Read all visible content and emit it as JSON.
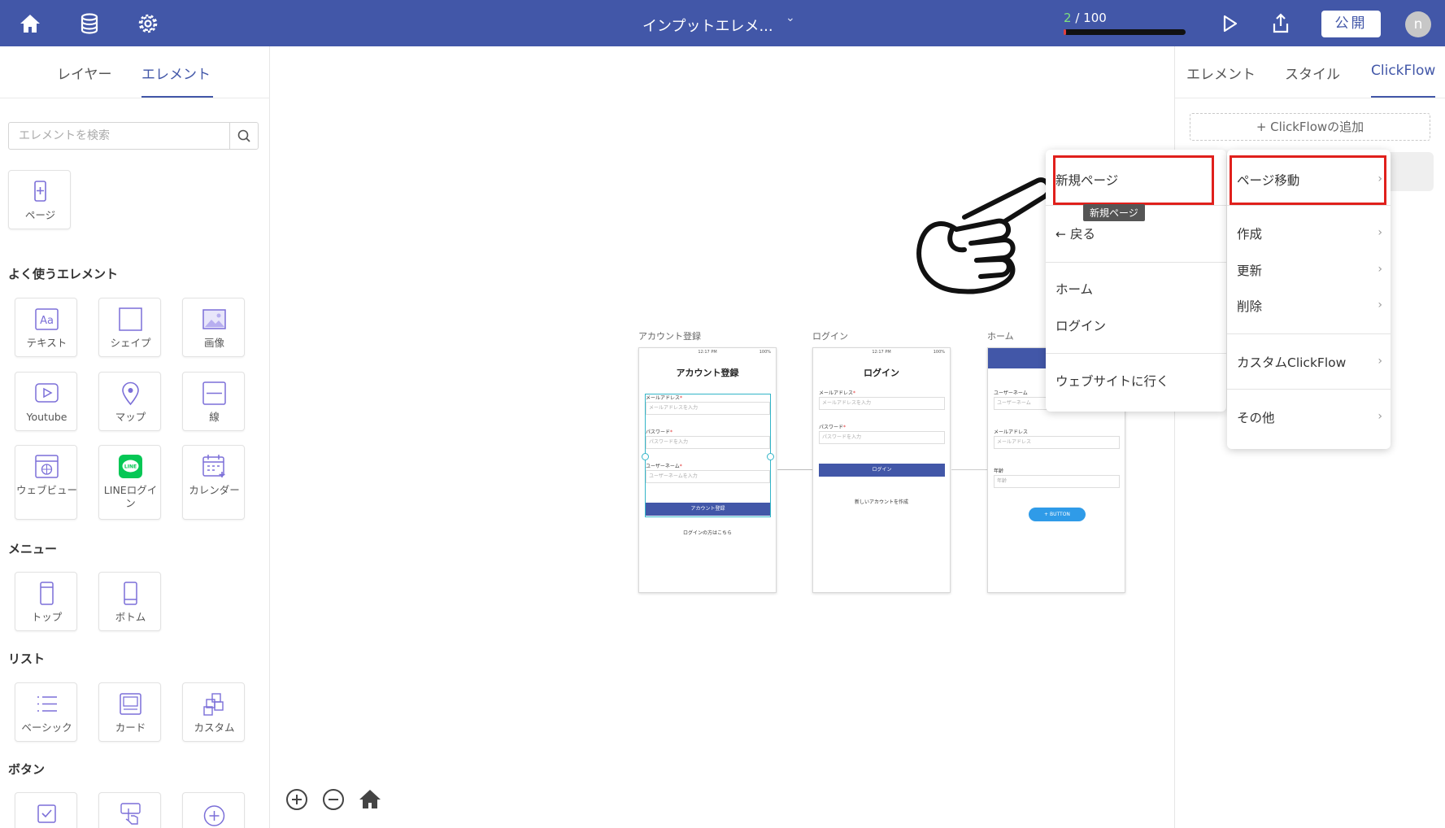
{
  "topbar": {
    "title": "インプットエレメ...",
    "progress_current": "2",
    "progress_total": "/ 100",
    "progress_fraction": 0.02,
    "publish_label": "公開",
    "avatar_initial": "n",
    "colors": {
      "bar": "#4257a8",
      "progress_current": "#7ee07e"
    },
    "icons": [
      "home-icon",
      "database-icon",
      "settings-icon",
      "chevron-down-icon",
      "play-icon",
      "share-icon"
    ]
  },
  "left_panel": {
    "tabs": [
      "レイヤー",
      "エレメント"
    ],
    "active_tab": "エレメント",
    "search_placeholder": "エレメントを検索",
    "page_tile": "ページ",
    "sections": {
      "frequent": {
        "title": "よく使うエレメント",
        "items": [
          "テキスト",
          "シェイプ",
          "画像",
          "Youtube",
          "マップ",
          "線",
          "ウェブビュー",
          "LINEログイン",
          "カレンダー"
        ]
      },
      "menu": {
        "title": "メニュー",
        "items": [
          "トップ",
          "ボトム"
        ]
      },
      "list": {
        "title": "リスト",
        "items": [
          "ベーシック",
          "カード",
          "カスタム"
        ]
      },
      "button": {
        "title": "ボタン"
      }
    }
  },
  "canvas": {
    "frames": [
      {
        "label": "アカウント登録",
        "title": "アカウント登録",
        "status_time": "12:17 PM",
        "status_battery": "100%",
        "fields": [
          {
            "label": "メールアドレス",
            "placeholder": "メールアドレスを入力"
          },
          {
            "label": "パスワード",
            "placeholder": "パスワードを入力"
          },
          {
            "label": "ユーザーネーム",
            "placeholder": "ユーザーネームを入力"
          }
        ],
        "button": "アカウント登録",
        "link": "ログインの方はこちら"
      },
      {
        "label": "ログイン",
        "title": "ログイン",
        "status_time": "12:17 PM",
        "status_battery": "100%",
        "fields": [
          {
            "label": "メールアドレス",
            "placeholder": "メールアドレスを入力"
          },
          {
            "label": "パスワード",
            "placeholder": "パスワードを入力"
          }
        ],
        "button": "ログイン",
        "link": "新しいアカウントを作成"
      },
      {
        "label": "ホーム",
        "fields": [
          {
            "label": "ユーザーネーム",
            "placeholder": "ユーザーネーム"
          },
          {
            "label": "メールアドレス",
            "placeholder": "メールアドレス"
          },
          {
            "label": "年齢",
            "placeholder": "年齢"
          }
        ],
        "button": "+ BUTTON"
      }
    ]
  },
  "right_panel": {
    "tabs": [
      "エレメント",
      "スタイル",
      "ClickFlow"
    ],
    "active_tab": "ClickFlow",
    "add_button": "ClickFlowの追加"
  },
  "context_menu_left": {
    "items": [
      "新規ページ",
      "戻る",
      "ホーム",
      "ログイン",
      "ウェブサイトに行く"
    ],
    "back_arrow": "←"
  },
  "tooltip": "新規ページ",
  "context_menu_right": {
    "items": [
      "ページ移動",
      "作成",
      "更新",
      "削除",
      "カスタムClickFlow",
      "その他"
    ]
  }
}
